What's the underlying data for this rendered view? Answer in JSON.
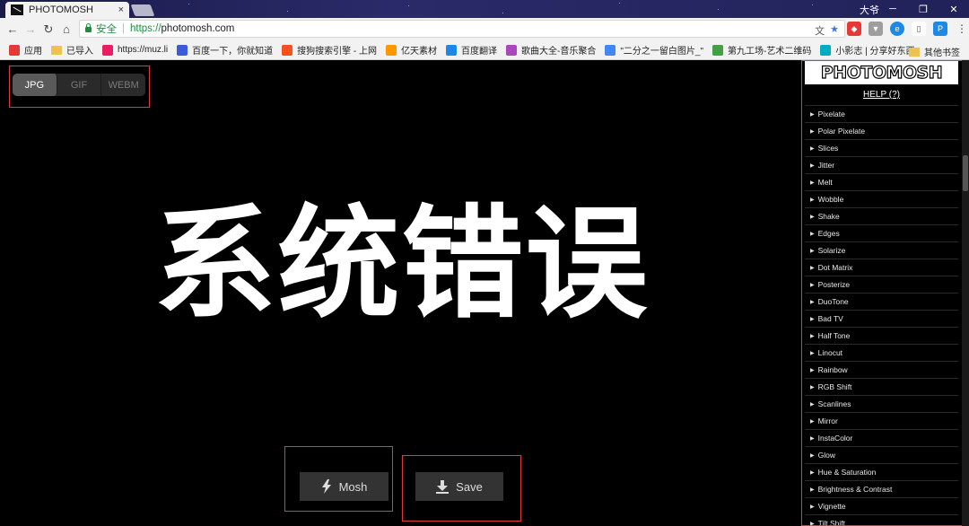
{
  "browser": {
    "tab_title": "PHOTOMOSH",
    "tab_close": "×",
    "user_label": "大爷",
    "address": {
      "secure_label": "安全",
      "url_scheme": "https://",
      "url_host": "photomosh.com"
    },
    "bookmarks": [
      {
        "label": "应用",
        "icon": "apps-grid-icon",
        "color": "#e53935"
      },
      {
        "label": "已导入",
        "icon": "folder-icon",
        "color": "#f0c050"
      },
      {
        "label": "https://muz.li",
        "icon": "muzli-icon",
        "color": "#e91e63"
      },
      {
        "label": "百度一下，你就知道",
        "icon": "baidu-icon",
        "color": "#3b5bdb"
      },
      {
        "label": "搜狗搜索引擎 - 上网",
        "icon": "sogou-icon",
        "color": "#f4511e"
      },
      {
        "label": "亿天素材",
        "icon": "fox-icon",
        "color": "#ff9800"
      },
      {
        "label": "百度翻译",
        "icon": "translate-icon",
        "color": "#1e88e5"
      },
      {
        "label": "歌曲大全-音乐聚合",
        "icon": "music-icon",
        "color": "#ab47bc"
      },
      {
        "label": "\"二分之一留白图片_\"",
        "icon": "chrome-icon",
        "color": "#4285f4"
      },
      {
        "label": "第九工场-艺术二维码",
        "icon": "qr-icon",
        "color": "#43a047"
      },
      {
        "label": "小影志 | 分享好东西",
        "icon": "xiaoying-icon",
        "color": "#00acc1"
      }
    ],
    "other_bookmarks": "其他书签"
  },
  "app": {
    "formats": [
      {
        "label": "JPG",
        "active": true
      },
      {
        "label": "GIF",
        "active": false
      },
      {
        "label": "WEBM",
        "active": false
      }
    ],
    "canvas_text": "系统错误",
    "mosh_button": "Mosh",
    "save_button": "Save",
    "highlight_color": "#e0393e"
  },
  "panel": {
    "logo": "PHOTOMOSH",
    "help": "HELP (?)",
    "effects": [
      "Pixelate",
      "Polar Pixelate",
      "Slices",
      "Jitter",
      "Melt",
      "Wobble",
      "Shake",
      "Edges",
      "Solarize",
      "Dot Matrix",
      "Posterize",
      "DuoTone",
      "Bad TV",
      "Half Tone",
      "Linocut",
      "Rainbow",
      "RGB Shift",
      "Scanlines",
      "Mirror",
      "InstaColor",
      "Glow",
      "Hue & Saturation",
      "Brightness & Contrast",
      "Vignette",
      "Tilt Shift"
    ]
  }
}
